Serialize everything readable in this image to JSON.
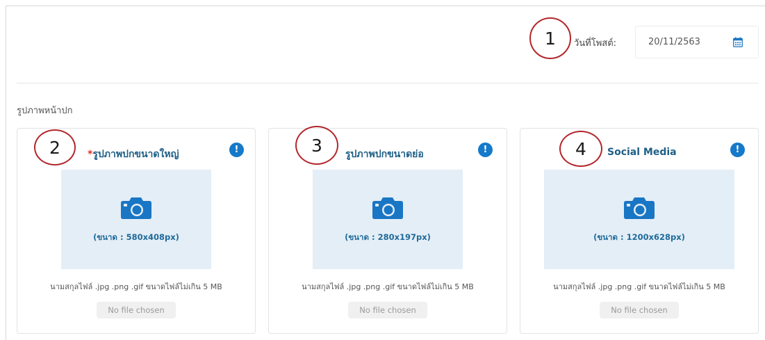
{
  "header": {
    "date_label": "วันที่โพสต์:",
    "date_value": "20/11/2563",
    "date_icon": "calendar-icon"
  },
  "section": {
    "title": "รูปภาพหน้าปก"
  },
  "callouts": [
    "1",
    "2",
    "3",
    "4"
  ],
  "cards": [
    {
      "required_mark": "*",
      "title": "รูปภาพปกขนาดใหญ่",
      "size_text": "(ขนาด : 580x408px)",
      "hint": "นามสกุลไฟล์ .jpg .png .gif ขนาดไฟล์ไม่เกิน 5 MB",
      "file_button": "No file chosen",
      "info_icon": "!"
    },
    {
      "required_mark": "",
      "title": "รูปภาพปกขนาดย่อ",
      "size_text": "(ขนาด : 280x197px)",
      "hint": "นามสกุลไฟล์ .jpg .png .gif ขนาดไฟล์ไม่เกิน 5 MB",
      "file_button": "No file chosen",
      "info_icon": "!"
    },
    {
      "required_mark": "",
      "title": "Social Media",
      "size_text": "(ขนาด : 1200x628px)",
      "hint": "นามสกุลไฟล์ .jpg .png .gif ขนาดไฟล์ไม่เกิน 5 MB",
      "file_button": "No file chosen",
      "info_icon": "!"
    }
  ],
  "colors": {
    "title_blue": "#1f5f86",
    "info_blue": "#1679c9",
    "camera_blue": "#1976c4",
    "drop_zone_bg": "#e4eef7",
    "required_red": "#e0332f",
    "callout_red": "#b3262b"
  }
}
